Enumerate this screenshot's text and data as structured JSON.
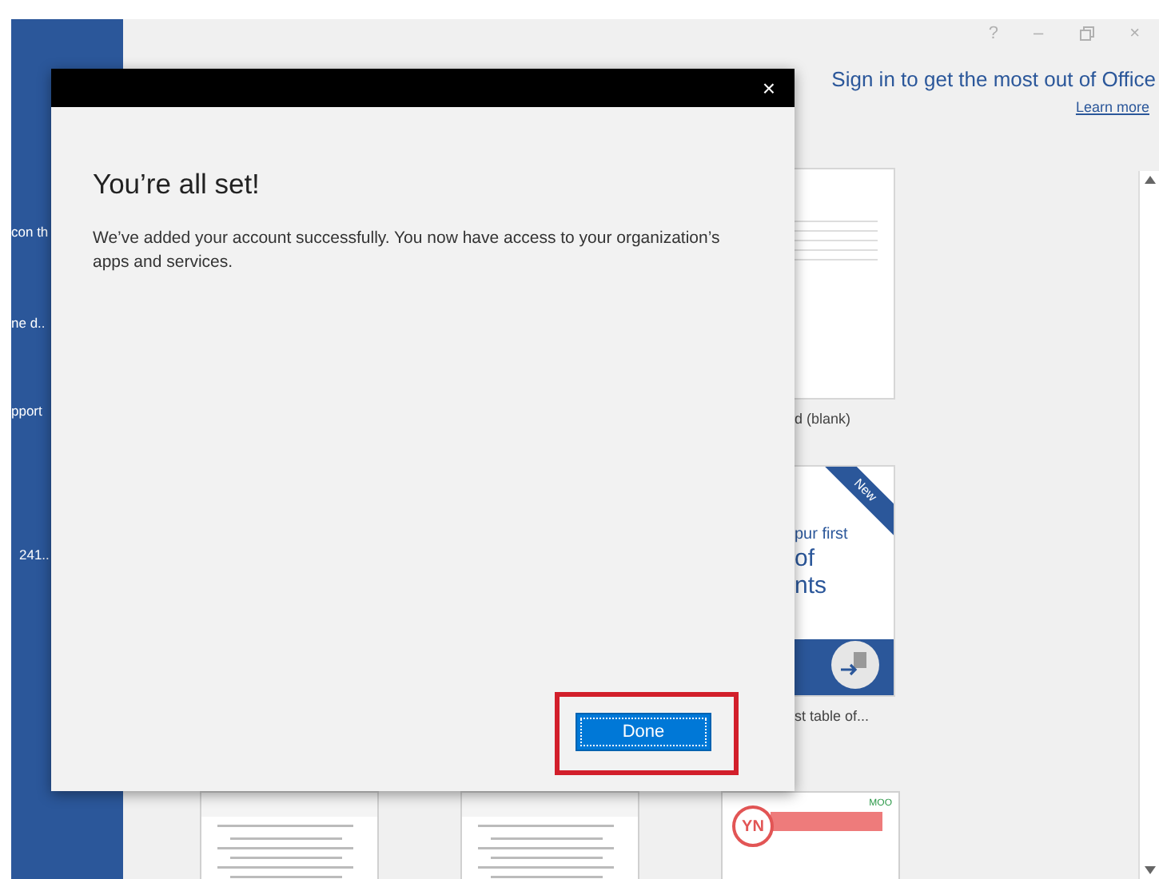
{
  "window_controls": [
    "?",
    "–",
    "×"
  ],
  "sidebar": {
    "items": [
      {
        "label": "con th"
      },
      {
        "label": "ne d.."
      },
      {
        "label": "pport"
      },
      {
        "label": "241.."
      }
    ]
  },
  "header": {
    "title": "Sign in to get the most out of Office",
    "link": "Learn more"
  },
  "templates": [
    {
      "kind": "blank",
      "caption": "d (blank)"
    },
    {
      "kind": "tour",
      "badge": "New",
      "lines": [
        "pur first",
        "of",
        "nts"
      ],
      "caption": "st table of..."
    }
  ],
  "bottom_templates": [
    {
      "kind": "resume"
    },
    {
      "kind": "resume"
    },
    {
      "kind": "red-resume",
      "initials": "YN",
      "logo": "MOO"
    }
  ],
  "dialog": {
    "title": "You’re all set!",
    "message": "We’ve added your account successfully. You now have access to your organization’s apps and services.",
    "button": "Done",
    "close": "×",
    "highlighted": true
  }
}
